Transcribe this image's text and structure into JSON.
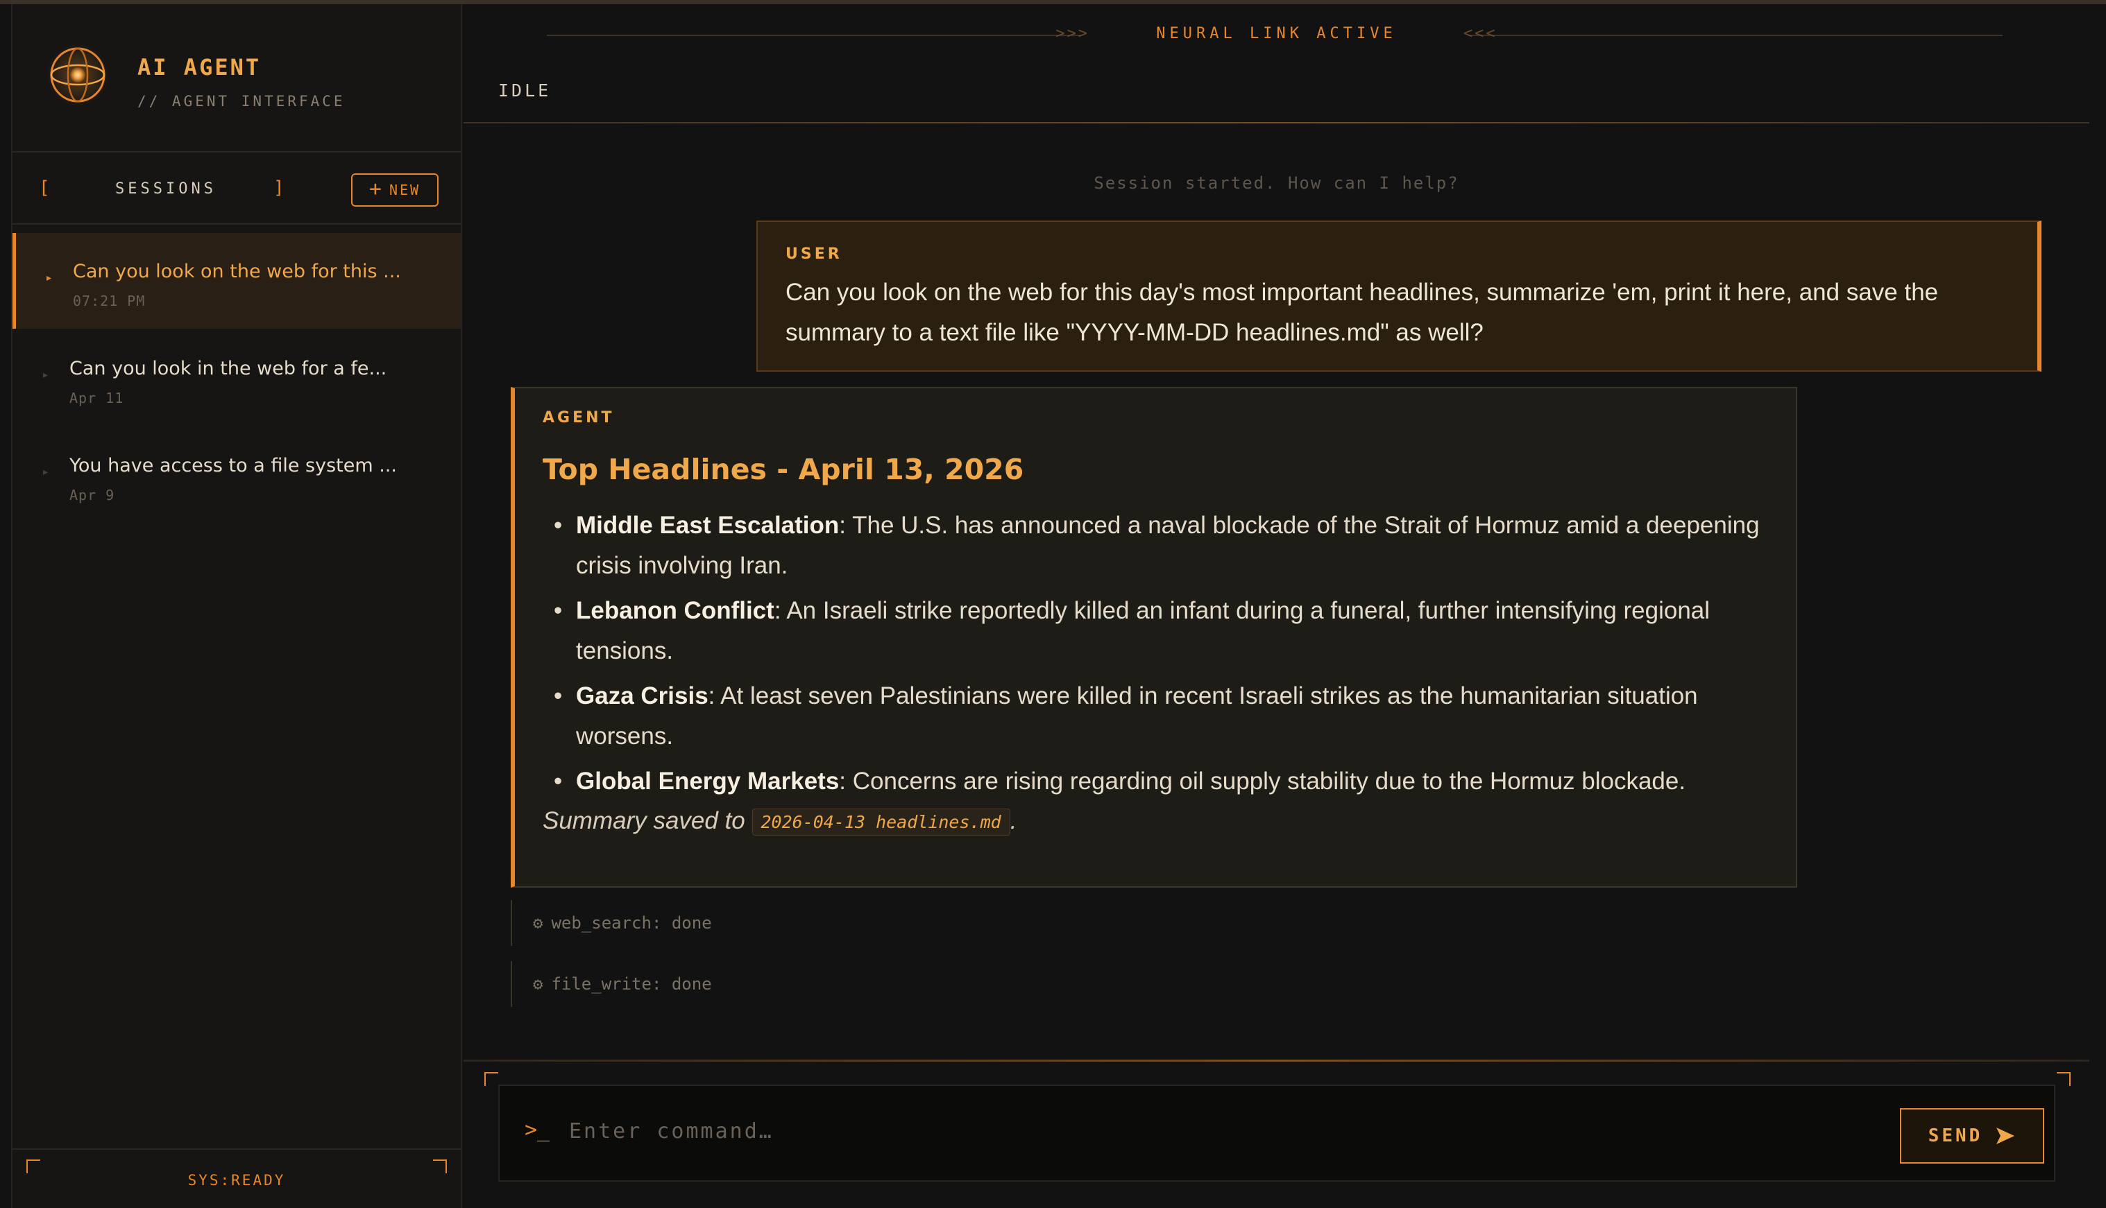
{
  "brand": {
    "title": "AI AGENT",
    "subtitle": "// AGENT INTERFACE"
  },
  "sessions": {
    "bracket_open": "[",
    "bracket_close": "]",
    "label": "SESSIONS",
    "new_label": "NEW",
    "items": [
      {
        "title": "Can you look on the web for this ...",
        "time": "07:21 PM",
        "active": true
      },
      {
        "title": "Can you look in the web for a fe...",
        "time": "Apr 11",
        "active": false
      },
      {
        "title": "You have access to a file system ...",
        "time": "Apr 9",
        "active": false
      }
    ]
  },
  "sidebar_footer": {
    "status": "SYS:READY"
  },
  "header": {
    "banner_left": ">>>",
    "banner": "NEURAL LINK ACTIVE",
    "banner_right": "<<<",
    "status": "IDLE"
  },
  "chat": {
    "session_started": "Session started. How can I help?",
    "user": {
      "role": "USER",
      "text": "Can you look on the web for this day's most important headlines, summarize 'em, print it here, and save the summary to a text file like \"YYYY-MM-DD headlines.md\" as well?"
    },
    "agent": {
      "role": "AGENT",
      "heading": "Top Headlines - April 13, 2026",
      "items": [
        {
          "title": "Middle East Escalation",
          "text": ": The U.S. has announced a naval blockade of the Strait of Hormuz amid a deepening crisis involving Iran."
        },
        {
          "title": "Lebanon Conflict",
          "text": ": An Israeli strike reportedly killed an infant during a funeral, further intensifying regional tensions."
        },
        {
          "title": "Gaza Crisis",
          "text": ": At least seven Palestinians were killed in recent Israeli strikes as the humanitarian situation worsens."
        },
        {
          "title": "Global Energy Markets",
          "text": ": Concerns are rising regarding oil supply stability due to the Hormuz blockade."
        }
      ],
      "summary_prefix": "Summary saved to ",
      "summary_file": "2026-04-13 headlines.md",
      "summary_suffix": "."
    },
    "tools": [
      {
        "label": "web_search: done"
      },
      {
        "label": "file_write: done"
      }
    ]
  },
  "input": {
    "prompt": ">_",
    "placeholder": "Enter command…",
    "send_label": "SEND"
  },
  "colors": {
    "accent": "#e8862c",
    "accent_light": "#f0a84a",
    "background": "#121212"
  }
}
